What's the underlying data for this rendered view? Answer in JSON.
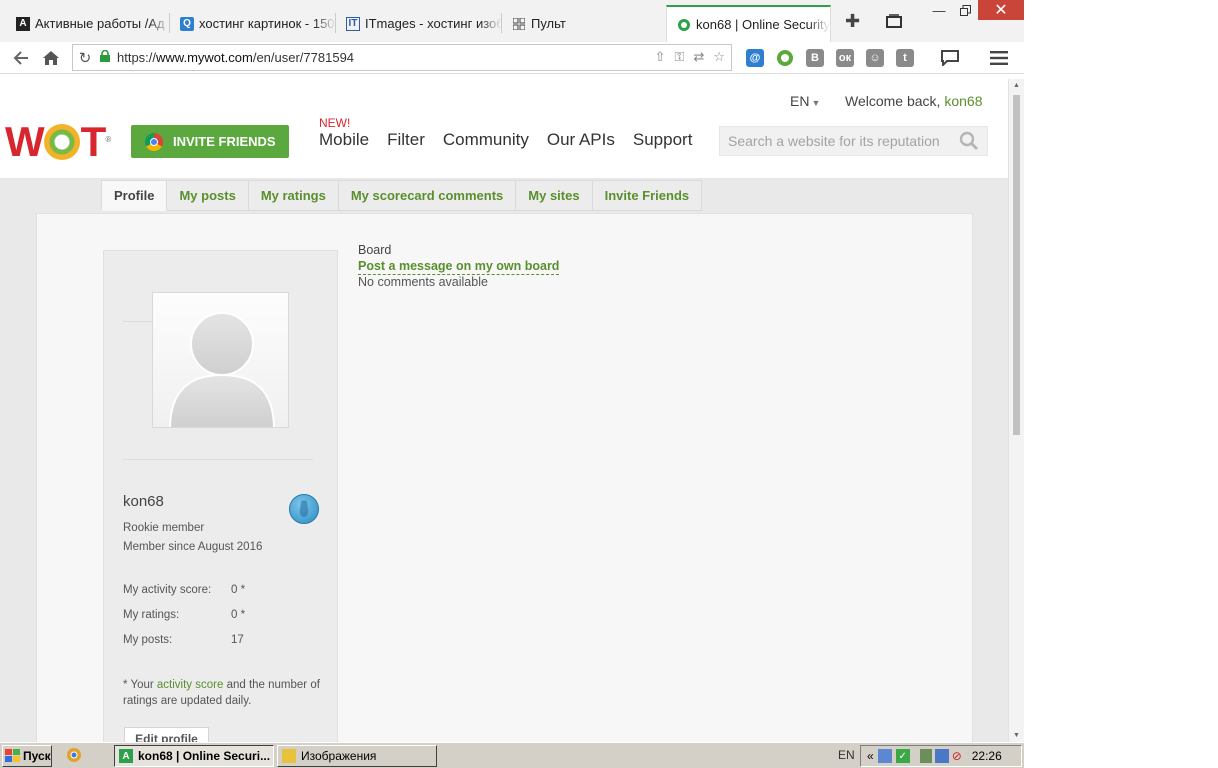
{
  "browser": {
    "tabs": [
      {
        "title": "Активные работы /Ад",
        "icon": "a-icon"
      },
      {
        "title": "хостинг картинок - 150",
        "icon": "search-q-icon"
      },
      {
        "title": "ITmages - хостинг изоб",
        "icon": "it-icon"
      },
      {
        "title": "Пульт",
        "icon": "grid-icon"
      },
      {
        "title": "kon68 | Online Security",
        "icon": "wot-icon",
        "active": true
      }
    ],
    "url_prefix": "https://",
    "url_host": "www.mywot.com",
    "url_path": "/en/user/7781594"
  },
  "site": {
    "logo_text_w": "W",
    "logo_text_t": "T",
    "logo_reg": "®",
    "invite_label": "INVITE FRIENDS",
    "new_badge": "NEW!",
    "nav": [
      "Mobile",
      "Filter",
      "Community",
      "Our APIs",
      "Support"
    ],
    "lang": "EN",
    "welcome_prefix": "Welcome back,",
    "welcome_user": "kon68",
    "search_placeholder": "Search a website for its reputation"
  },
  "subtabs": [
    "Profile",
    "My posts",
    "My ratings",
    "My scorecard comments",
    "My sites",
    "Invite Friends"
  ],
  "profile": {
    "username": "kon68",
    "rank": "Rookie member",
    "member_since": "Member since August 2016",
    "stats": [
      {
        "label": "My activity score:",
        "value": "0 *"
      },
      {
        "label": "My ratings:",
        "value": "0 *"
      },
      {
        "label": "My posts:",
        "value": "17"
      }
    ],
    "note_prefix": "* Your",
    "note_link": "activity score",
    "note_suffix": "and the number of ratings are updated daily.",
    "edit_label": "Edit profile"
  },
  "board": {
    "label": "Board",
    "post_link": "Post a message on my own board",
    "empty": "No comments available"
  },
  "taskbar": {
    "start": "Пуск",
    "tasks": [
      {
        "title": "kon68 | Online Securi...",
        "active": true
      },
      {
        "title": "Изображения",
        "active": false
      }
    ],
    "lang": "EN",
    "time": "22:26"
  }
}
